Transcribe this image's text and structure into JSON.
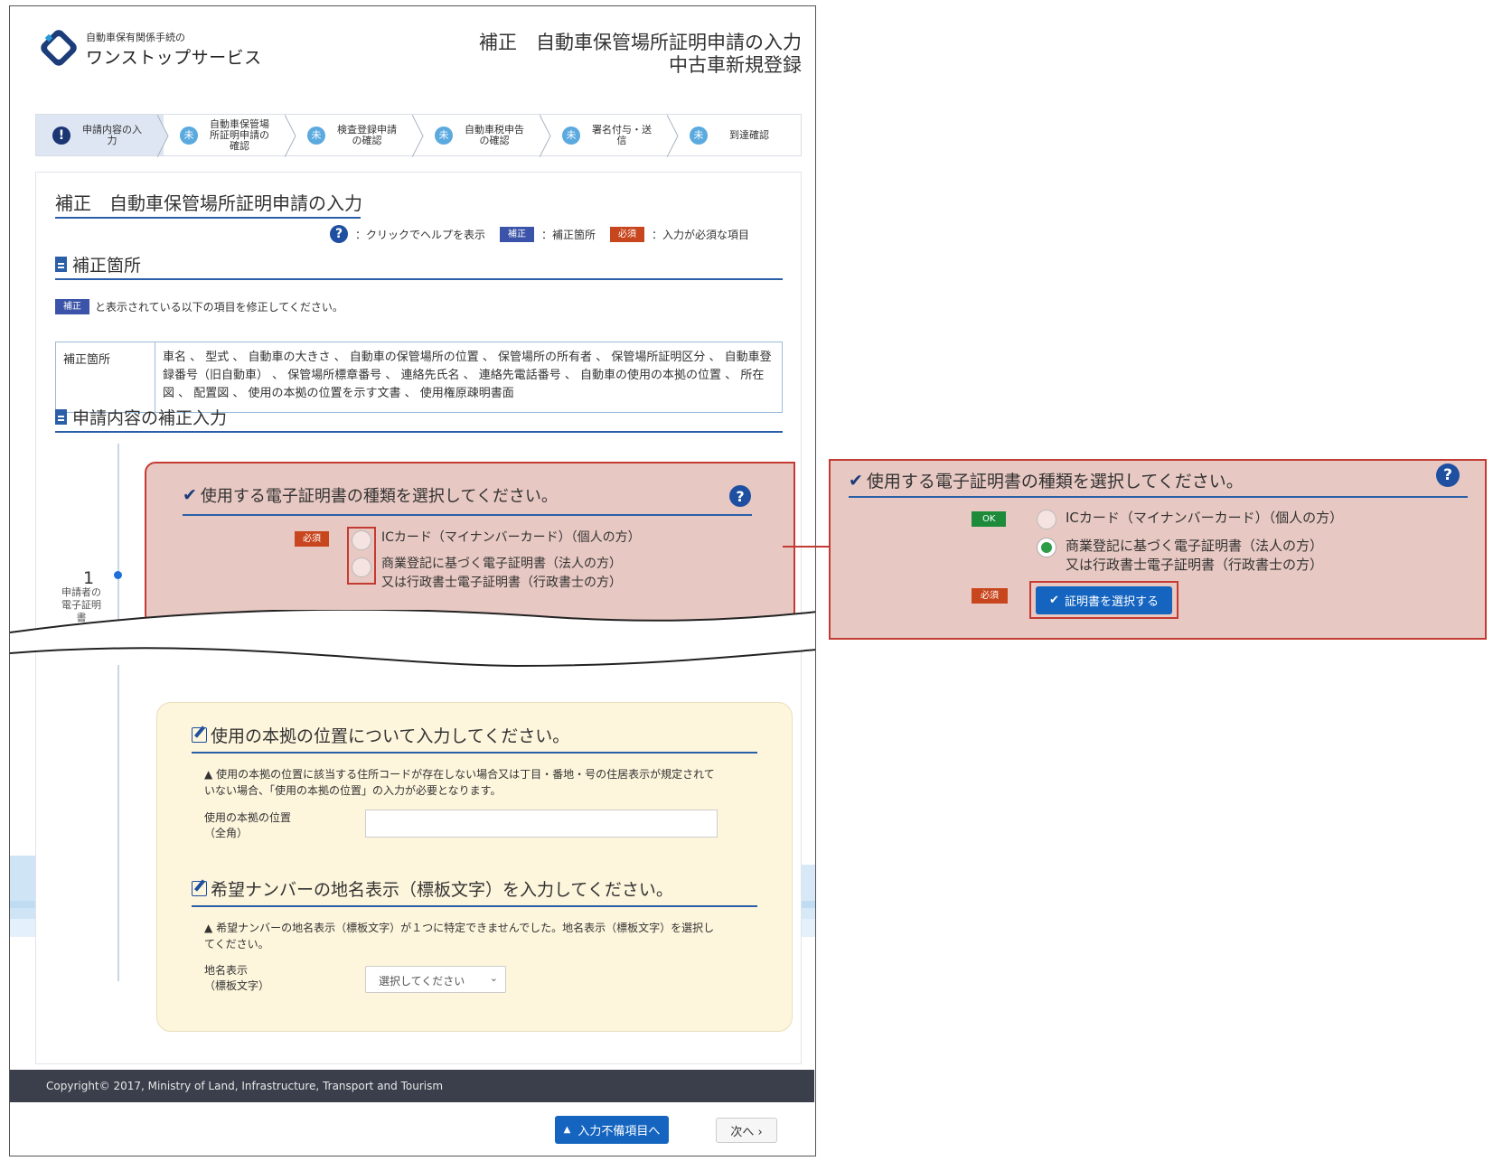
{
  "header": {
    "logo_small": "自動車保有関係手続の",
    "logo_big": "ワンストップサービス",
    "title_line1": "補正　自動車保管場所証明申請の入力",
    "title_line2": "中古車新規登録"
  },
  "stepper": [
    {
      "icon": "!",
      "label": "申請内容の入力"
    },
    {
      "icon": "未",
      "label": "自動車保管場所証明申請の確認"
    },
    {
      "icon": "未",
      "label": "検査登録申請の確認"
    },
    {
      "icon": "未",
      "label": "自動車税申告の確認"
    },
    {
      "icon": "未",
      "label": "署名付与・送信"
    },
    {
      "icon": "未",
      "label": "到達確認"
    }
  ],
  "page": {
    "heading": "補正　自動車保管場所証明申請の入力",
    "legend_help": "：クリックでヘルプを表示",
    "badge_hosei": "補正",
    "legend_hosei": "：補正箇所",
    "badge_hissu": "必須",
    "legend_hissu": "：入力が必須な項目",
    "section1": "補正箇所",
    "notice": "と表示されている以下の項目を修正してください。",
    "table_head": "補正箇所",
    "table_body": "車名 、 型式 、 自動車の大きさ 、 自動車の保管場所の位置 、 保管場所の所有者 、 保管場所証明区分 、 自動車登録番号（旧自動車） 、 保管場所標章番号 、 連絡先氏名 、 連絡先電話番号 、 自動車の使用の本拠の位置 、 所在図 、 配置図 、 使用の本拠の位置を示す文書 、 使用権原疎明書面",
    "section2": "申請内容の補正入力",
    "step_no": "1",
    "step_label": "申請者の電子証明書"
  },
  "cert_panel": {
    "title": "使用する電子証明書の種類を選択してください。",
    "option1": "ICカード（マイナンバーカード）（個人の方）",
    "option2_line1": "商業登記に基づく電子証明書（法人の方）",
    "option2_line2": "又は行政書士電子証明書（行政書士の方）"
  },
  "zoom_panel": {
    "badge_ok": "OK",
    "badge_hissu": "必須",
    "select_cert_button": "証明書を選択する",
    "selected_option": 2
  },
  "location_panel": {
    "title": "使用の本拠の位置について入力してください。",
    "warning": "使用の本拠の位置に該当する住所コードが存在しない場合又は丁目・番地・号の住居表示が規定されていない場合、「使用の本拠の位置」の入力が必要となります。",
    "field_label1": "使用の本拠の位置",
    "field_label2": "（全角）",
    "field_value": ""
  },
  "plate_panel": {
    "title": "希望ナンバーの地名表示（標板文字）を入力してください。",
    "warning": "希望ナンバーの地名表示（標板文字）が１つに特定できませんでした。地名表示（標板文字）を選択してください。",
    "field_label1": "地名表示",
    "field_label2": "（標板文字）",
    "select_value": "選択してください"
  },
  "footer": {
    "copyright": "Copyright© 2017, Ministry of Land, Infrastructure, Transport and Tourism",
    "btn_incomplete": "入力不備項目へ",
    "btn_next": "次へ ›"
  },
  "colors": {
    "accent": "#1565c0",
    "highlight_red": "#c43b33",
    "panel_pink": "#e7c8c2",
    "panel_yellow": "#fdf5dc",
    "badge_hosei": "#3b53a8",
    "badge_hissu": "#c8461e",
    "badge_ok": "#1d8b3a"
  }
}
